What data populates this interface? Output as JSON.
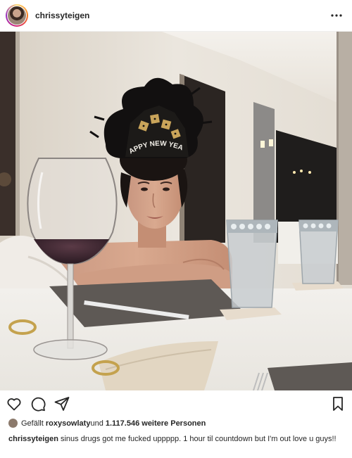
{
  "post": {
    "username": "chrissyteigen",
    "more_icon": "more-horizontal-icon"
  },
  "actions": {
    "like_icon": "heart-icon",
    "comment_icon": "comment-icon",
    "share_icon": "share-icon",
    "save_icon": "bookmark-icon"
  },
  "likes": {
    "prefix": "Gefällt ",
    "liker": "roxysowlaty",
    "middle": " und ",
    "count": "1.117.546 weitere Personen"
  },
  "caption": {
    "username": "chrissyteigen",
    "text": " sinus drugs got me fucked uppppp. 1 hour til countdown but I'm out love u guys!!"
  },
  "photo": {
    "tiara_text": "APPY NEW YEA"
  },
  "colors": {
    "text": "#262626",
    "border": "#efefef",
    "background": "#ffffff"
  }
}
